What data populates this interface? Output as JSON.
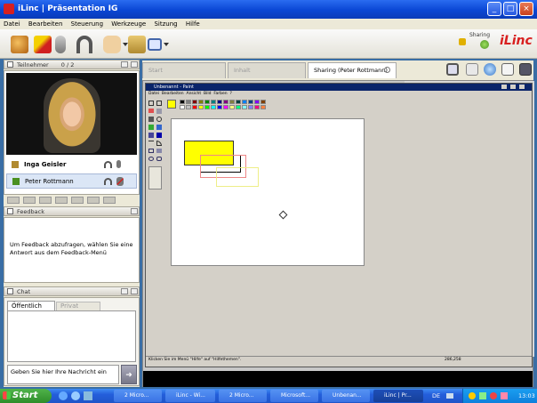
{
  "window": {
    "title": "iLinc | Präsentation IG",
    "min": "_",
    "max": "□",
    "close": "×"
  },
  "menu": [
    "Datei",
    "Bearbeiten",
    "Steuerung",
    "Werkzeuge",
    "Sitzung",
    "Hilfe"
  ],
  "toolbar": {
    "sharing_label": "Sharing",
    "brand": "iLinc"
  },
  "participants": {
    "header": "Teilnehmer",
    "count": "0 / 2",
    "people": [
      {
        "name": "Inga Geisler"
      },
      {
        "name": "Peter Rottmann"
      }
    ]
  },
  "feedback": {
    "header": "Feedback",
    "text": "Um Feedback abzufragen, wählen Sie eine Antwort aus dem Feedback-Menü"
  },
  "chat": {
    "header": "Chat",
    "tabs": [
      "Öffentlich",
      "Privat"
    ],
    "input_placeholder": "Geben Sie hier Ihre Nachricht ein"
  },
  "content_tabs": [
    "Start",
    "Inhalt",
    "Sharing (Peter Rottmann)"
  ],
  "paint": {
    "title": "Unbenannt - Paint",
    "menu": [
      "Datei",
      "Bearbeiten",
      "Ansicht",
      "Bild",
      "Farben",
      "?"
    ],
    "status": "Klicken Sie im Menü \"Hilfe\" auf \"Hilfethemen\".",
    "coords": "286,258",
    "palette": [
      "#000000",
      "#808080",
      "#800000",
      "#808000",
      "#008000",
      "#008080",
      "#000080",
      "#800080",
      "#808040",
      "#004040",
      "#0080ff",
      "#004080",
      "#8000ff",
      "#804000",
      "#ffffff",
      "#c0c0c0",
      "#ff0000",
      "#ffff00",
      "#00ff00",
      "#00ffff",
      "#0000ff",
      "#ff00ff",
      "#ffff80",
      "#00ff80",
      "#80ffff",
      "#8080ff",
      "#ff0080",
      "#ff8040"
    ]
  },
  "taskbar": {
    "start": "Start",
    "tasks": [
      "2 Micro...",
      "iLinc - Wi...",
      "2 Micro...",
      "Microsoft...",
      "Unbenan...",
      "iLinc | Pr..."
    ],
    "lang": "DE",
    "clock": "13:03"
  }
}
